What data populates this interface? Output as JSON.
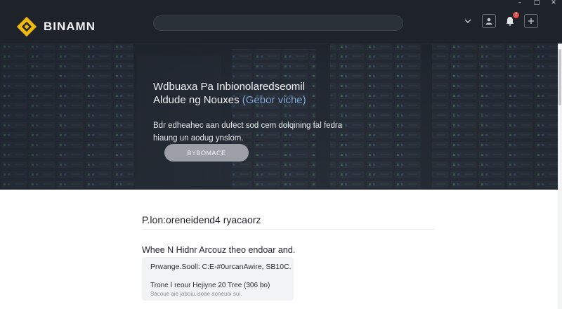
{
  "brand": {
    "name": "BINAMN",
    "accent": "#f0b90b"
  },
  "search": {
    "placeholder": ""
  },
  "notifications": {
    "count": "2"
  },
  "hero": {
    "title_line1": "Wdbuaxa Pa Inbionolaredseomil",
    "title_line2_prefix": "Aldude ng Nouxes",
    "title_line2_accent": "(Gebor viche)",
    "subtitle": "Bdr edheahec aan dufect sod cem dolqining fal fedra hiaung un aodug ynslom.",
    "cta_label": "BYBOMACE"
  },
  "section": {
    "title": "P.lon:oreneidend4 ryacaorz",
    "lead": "Whee N Hidnr Arcouz theo endoar and.",
    "card_line1": "Prwange.Sooll: C:E-#0urcanAwire, SB10C.",
    "card_line2": "Trone I reour Hejiyne 20 Tree (306 bo)",
    "card_line3": "Sacoue aie jaboiu.isoae aoneuoi sui."
  },
  "colors": {
    "nav_bg": "#1e2329",
    "hero_accent": "#7fa9d9",
    "cta_bg": "#9ca0a6",
    "notif_badge": "#e24a4a"
  },
  "icons": {
    "logo": "diamond-logo-icon",
    "dropdown": "chevron-down-icon",
    "user": "user-icon",
    "bell": "bell-icon",
    "add": "plus-icon",
    "minimize": "minimize-icon",
    "maximize": "maximize-icon",
    "close": "close-icon"
  }
}
